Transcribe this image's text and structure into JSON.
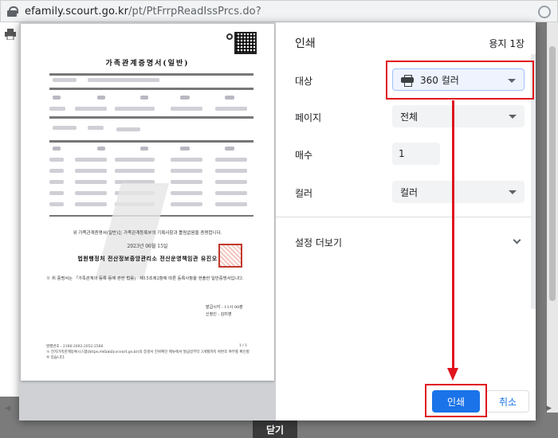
{
  "browser": {
    "url_host": "efamily.scourt.go.kr",
    "url_path": "/pt/PtFrrpReadIssPrcs.do?"
  },
  "background": {
    "close_label": "닫기"
  },
  "print_dialog": {
    "title": "인쇄",
    "sheet_count": "용지 1장",
    "destination": {
      "label": "대상",
      "value": "360 컬러"
    },
    "pages": {
      "label": "페이지",
      "value": "전체"
    },
    "copies": {
      "label": "매수",
      "value": "1"
    },
    "color": {
      "label": "컬러",
      "value": "컬러"
    },
    "more_settings": "설정 더보기",
    "print_button": "인쇄",
    "cancel_button": "취소"
  },
  "document_preview": {
    "title": "가족관계증명서(일반)",
    "sentence": "위 가족관계증명서(일반)는 가족관계등록부의 기록사항과 틀림없음을 증명합니다.",
    "date": "2023년 06월 15일",
    "issuer": "법원행정처 전산정보중앙관리소 전산운영책임관 유진오",
    "note": "※ 위 증명서는 「가족관계의 등록 등에 관한 법률」 제15조제2항에 따른 등록사항을 현출한 일반증명서입니다.",
    "issue_time": "발급시각 : 11시 00분",
    "issuer_person": "신청인 : 김미영",
    "footer_number": "발행번호 : 2166-2002-2052-2566",
    "footer_note": "※ 전자가족관계등록시스템(https://efamily.scourt.go.kr)의 증명서 진위확인 메뉴에서 발급일부터 3개월까지 위변조 여부를 확인할 수 있습니다.",
    "page_indicator": "1 / 1"
  },
  "annotation_color": "#e0141e",
  "accent_color": "#1a73e8"
}
